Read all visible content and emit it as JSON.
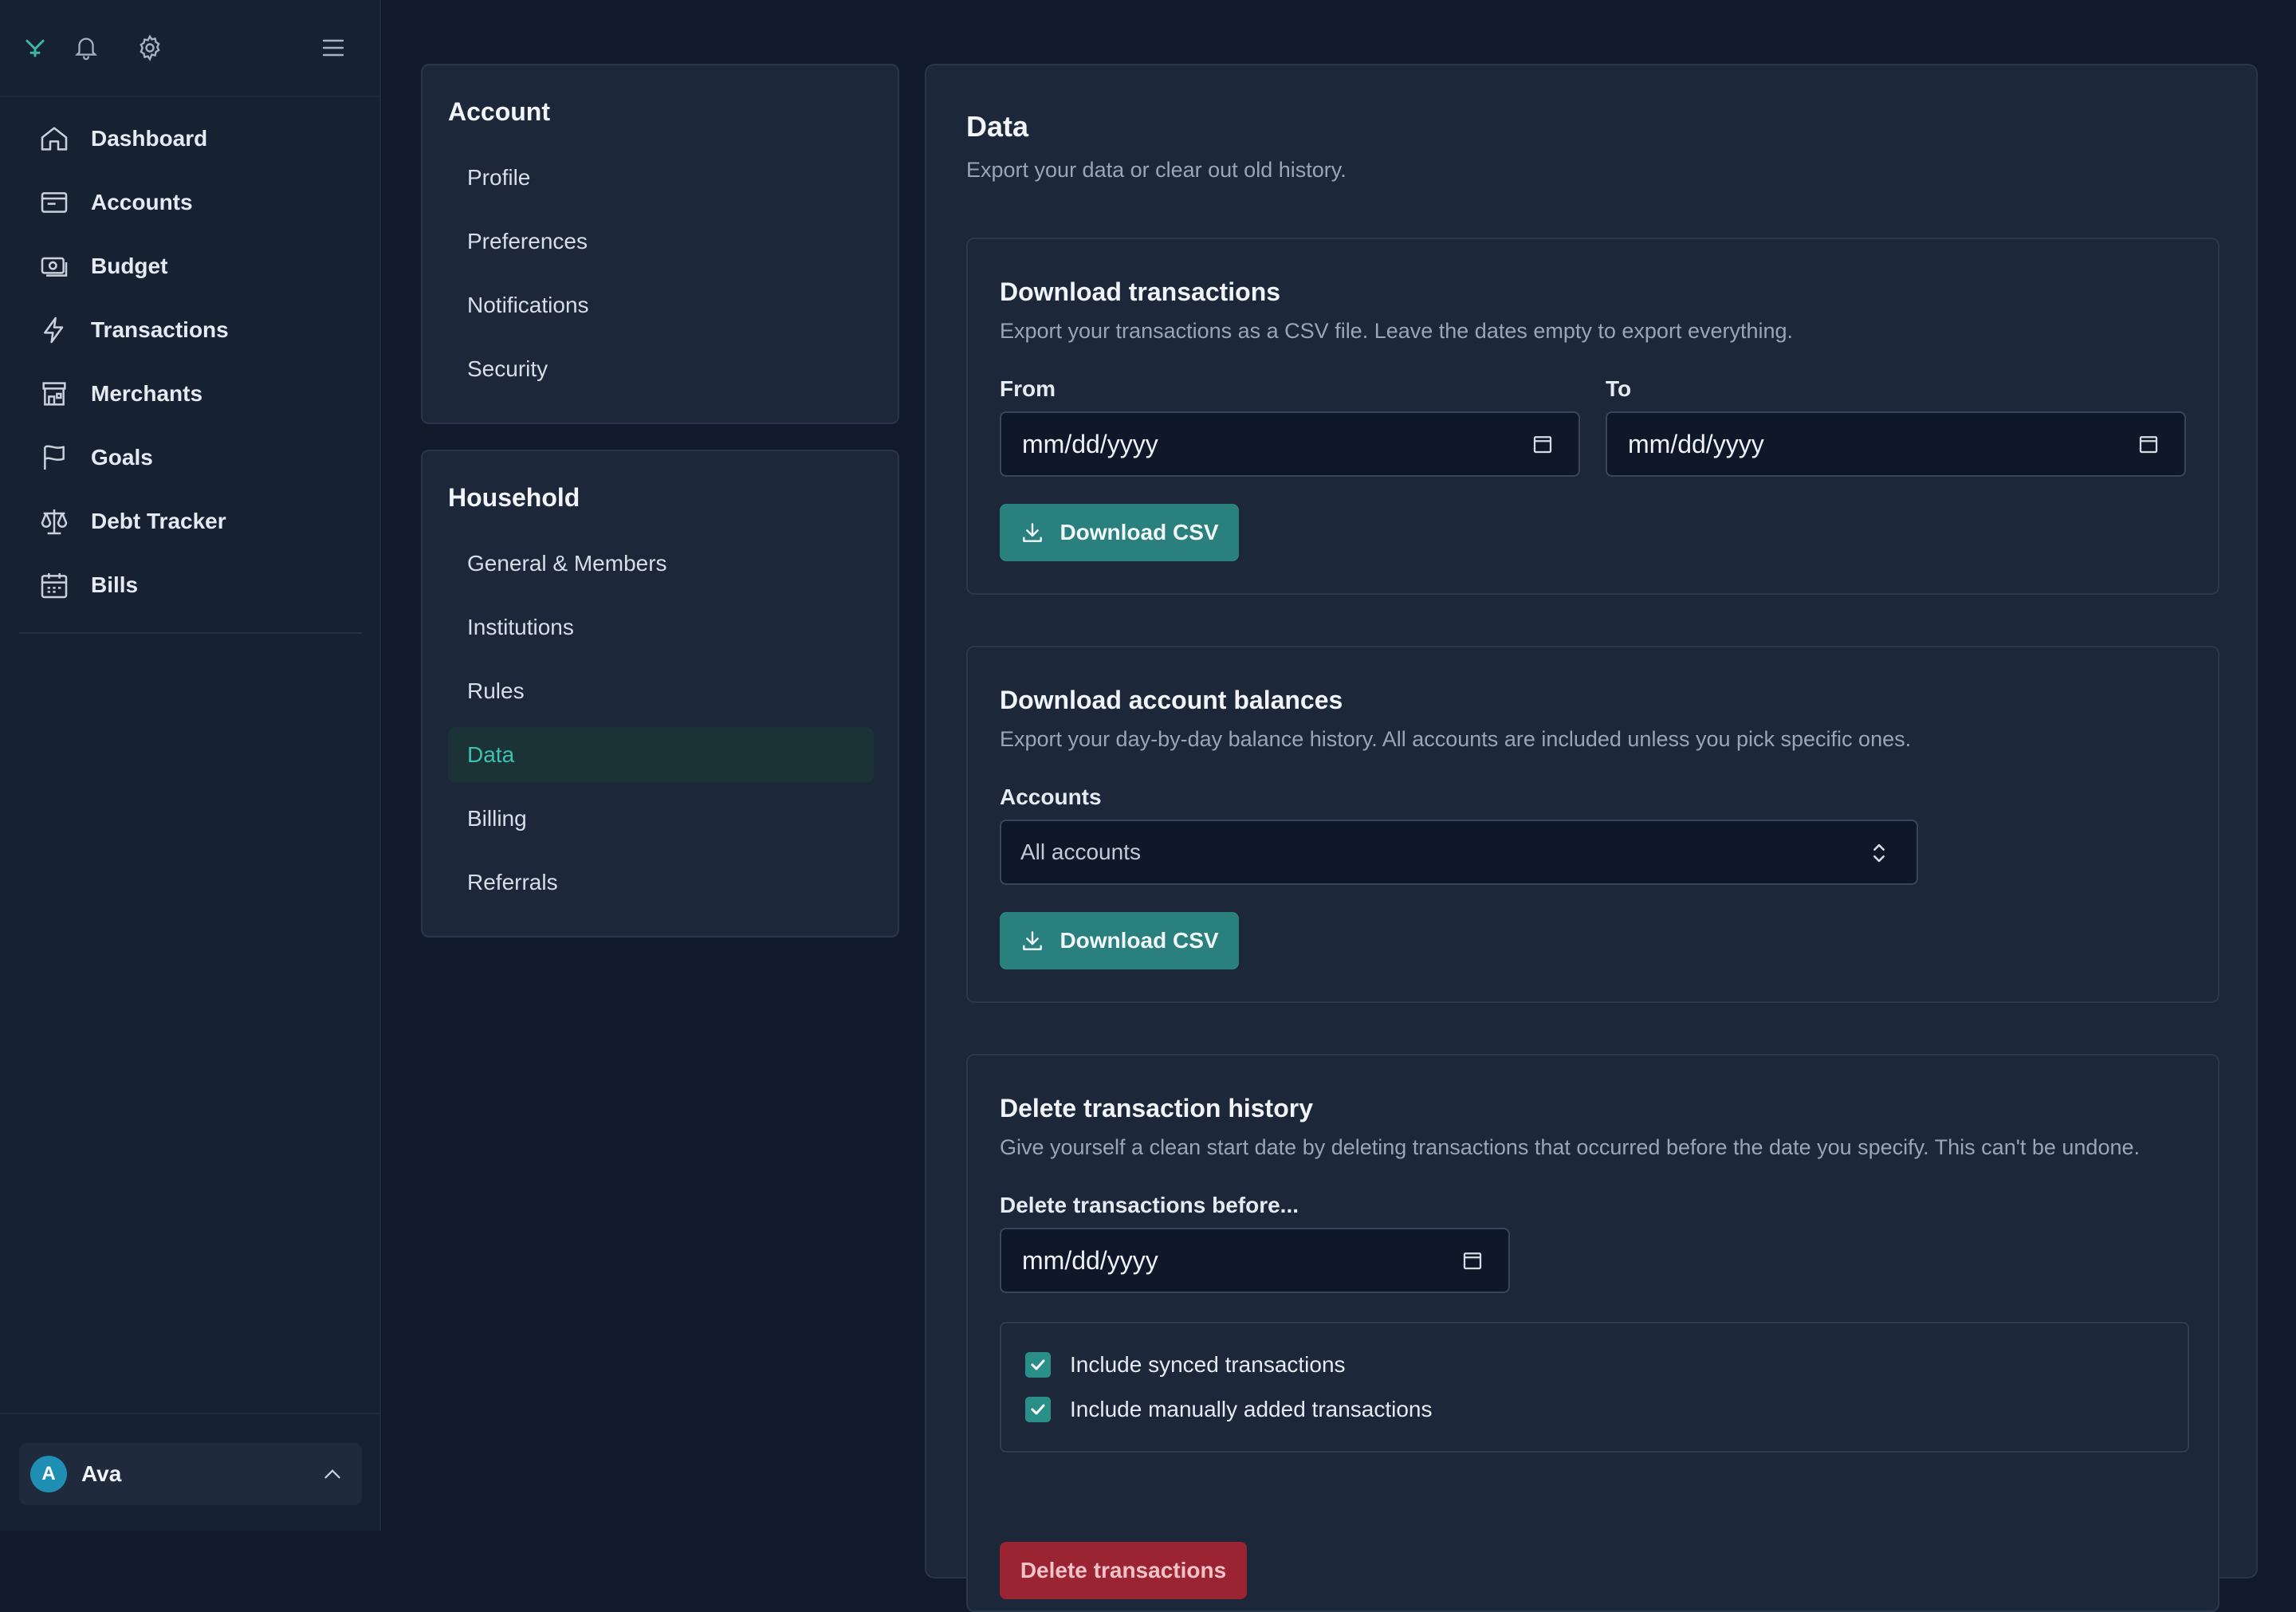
{
  "sidebar": {
    "top_icons": [
      "logo-icon",
      "bell-icon",
      "gear-icon",
      "menu-icon"
    ],
    "items": [
      {
        "label": "Dashboard",
        "icon": "home-icon"
      },
      {
        "label": "Accounts",
        "icon": "accounts-icon"
      },
      {
        "label": "Budget",
        "icon": "budget-icon"
      },
      {
        "label": "Transactions",
        "icon": "bolt-icon"
      },
      {
        "label": "Merchants",
        "icon": "store-icon"
      },
      {
        "label": "Goals",
        "icon": "flag-icon"
      },
      {
        "label": "Debt Tracker",
        "icon": "scale-icon"
      },
      {
        "label": "Bills",
        "icon": "calendar-icon"
      }
    ],
    "user": {
      "initial": "A",
      "name": "Ava"
    }
  },
  "settings_nav": {
    "account": {
      "title": "Account",
      "items": [
        "Profile",
        "Preferences",
        "Notifications",
        "Security"
      ]
    },
    "household": {
      "title": "Household",
      "items": [
        "General & Members",
        "Institutions",
        "Rules",
        "Data",
        "Billing",
        "Referrals"
      ],
      "active": "Data"
    }
  },
  "main": {
    "title": "Data",
    "subtitle": "Export your data or clear out old history.",
    "download_transactions": {
      "title": "Download transactions",
      "subtitle": "Export your transactions as a CSV file. Leave the dates empty to export everything.",
      "from_label": "From",
      "to_label": "To",
      "from_placeholder": "mm/dd/yyyy",
      "to_placeholder": "mm/dd/yyyy",
      "button": "Download CSV"
    },
    "download_balances": {
      "title": "Download account balances",
      "subtitle": "Export your day-by-day balance history. All accounts are included unless you pick specific ones.",
      "accounts_label": "Accounts",
      "accounts_value": "All accounts",
      "button": "Download CSV"
    },
    "delete_history": {
      "title": "Delete transaction history",
      "subtitle": "Give yourself a clean start date by deleting transactions that occurred before the date you specify. This can't be undone.",
      "date_label": "Delete transactions before...",
      "date_placeholder": "mm/dd/yyyy",
      "include_synced": "Include synced transactions",
      "include_manual": "Include manually added transactions",
      "button": "Delete transactions"
    }
  },
  "colors": {
    "accent": "#2a7f7f",
    "danger": "#9a2431",
    "active_nav_text": "#3fc0b0"
  }
}
